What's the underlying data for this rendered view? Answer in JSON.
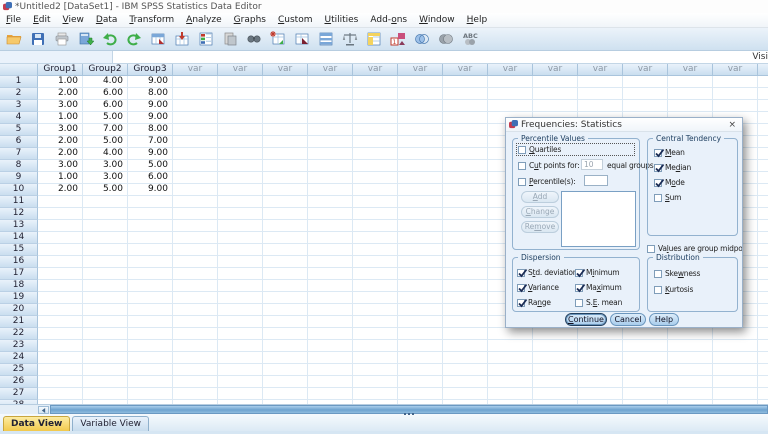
{
  "window": {
    "title": "*Untitled2 [DataSet1] - IBM SPSS Statistics Data Editor"
  },
  "menu": {
    "items": [
      {
        "label": "File",
        "u": 0
      },
      {
        "label": "Edit",
        "u": 0
      },
      {
        "label": "View",
        "u": 0
      },
      {
        "label": "Data",
        "u": 0
      },
      {
        "label": "Transform",
        "u": 0
      },
      {
        "label": "Analyze",
        "u": 0
      },
      {
        "label": "Graphs",
        "u": 0
      },
      {
        "label": "Custom",
        "u": 0
      },
      {
        "label": "Utilities",
        "u": 0
      },
      {
        "label": "Add-ons",
        "u": 4
      },
      {
        "label": "Window",
        "u": 0
      },
      {
        "label": "Help",
        "u": 0
      }
    ]
  },
  "toolbar": {
    "icons": [
      "open-file-icon",
      "save-icon",
      "print-icon",
      "recall-dialogs-icon",
      "undo-icon",
      "redo-icon",
      "goto-case-icon",
      "goto-variable-icon",
      "variables-icon",
      "file-info-icon",
      "find-icon",
      "insert-cases-icon",
      "insert-variable-icon",
      "split-file-icon",
      "weight-cases-icon",
      "select-cases-icon",
      "value-labels-icon",
      "use-variable-sets-icon",
      "show-all-variables-icon",
      "spellcheck-icon"
    ]
  },
  "cellref": {
    "visible_label": "Visi"
  },
  "grid": {
    "columns": [
      "Group1",
      "Group2",
      "Group3"
    ],
    "var_header": "var",
    "var_count": 14,
    "row_count": 28,
    "rows": [
      [
        "1.00",
        "4.00",
        "9.00"
      ],
      [
        "2.00",
        "6.00",
        "8.00"
      ],
      [
        "3.00",
        "6.00",
        "9.00"
      ],
      [
        "1.00",
        "5.00",
        "9.00"
      ],
      [
        "3.00",
        "7.00",
        "8.00"
      ],
      [
        "2.00",
        "5.00",
        "7.00"
      ],
      [
        "2.00",
        "4.00",
        "9.00"
      ],
      [
        "3.00",
        "3.00",
        "5.00"
      ],
      [
        "1.00",
        "3.00",
        "6.00"
      ],
      [
        "2.00",
        "5.00",
        "9.00"
      ]
    ]
  },
  "tabs": [
    {
      "label": "Data View",
      "active": true
    },
    {
      "label": "Variable View",
      "active": false
    }
  ],
  "dialog": {
    "title": "Frequencies: Statistics",
    "close_label": "×",
    "percentile": {
      "label": "Percentile Values",
      "quartiles": {
        "label": "Quartiles",
        "u": 0,
        "checked": false
      },
      "cut_points": {
        "label": "Cut points for:",
        "u": 1,
        "checked": false,
        "value": "10",
        "suffix": "equal groups"
      },
      "percentiles": {
        "label": "Percentile(s):",
        "u": 0,
        "checked": false,
        "value": ""
      },
      "add_label": {
        "label": "Add",
        "u": 0
      },
      "change_label": {
        "label": "Change",
        "u": 0
      },
      "remove_label": {
        "label": "Remove",
        "u": 2
      }
    },
    "central": {
      "label": "Central Tendency",
      "items": [
        {
          "label": "Mean",
          "u": 0,
          "checked": true
        },
        {
          "label": "Median",
          "u": 2,
          "checked": true
        },
        {
          "label": "Mode",
          "u": 1,
          "checked": true
        },
        {
          "label": "Sum",
          "u": 0,
          "checked": false
        }
      ]
    },
    "midpoints": {
      "label": "Values are group midpoints",
      "u": 2,
      "checked": false
    },
    "dispersion": {
      "label": "Dispersion",
      "col1": [
        {
          "label": "Std. deviation",
          "u": 1,
          "checked": true
        },
        {
          "label": "Variance",
          "u": 0,
          "checked": true
        },
        {
          "label": "Range",
          "u": 2,
          "checked": true
        }
      ],
      "col2": [
        {
          "label": "Minimum",
          "u": 1,
          "checked": true
        },
        {
          "label": "Maximum",
          "u": 2,
          "checked": true
        },
        {
          "label": "S.E. mean",
          "u": 2,
          "checked": false
        }
      ]
    },
    "distribution": {
      "label": "Distribution",
      "items": [
        {
          "label": "Skewness",
          "u": 3,
          "checked": false
        },
        {
          "label": "Kurtosis",
          "u": 0,
          "checked": false
        }
      ]
    },
    "buttons": [
      {
        "label": "Continue",
        "u": 0,
        "default": true
      },
      {
        "label": "Cancel",
        "u": -1,
        "default": false
      },
      {
        "label": "Help",
        "u": -1,
        "default": false
      }
    ]
  },
  "colors": {
    "tab_active": "#f2c94c",
    "dialog_bg": "#e9f1fa",
    "check": "#1b2c55",
    "scroll_thumb": "#6ea3cf"
  }
}
